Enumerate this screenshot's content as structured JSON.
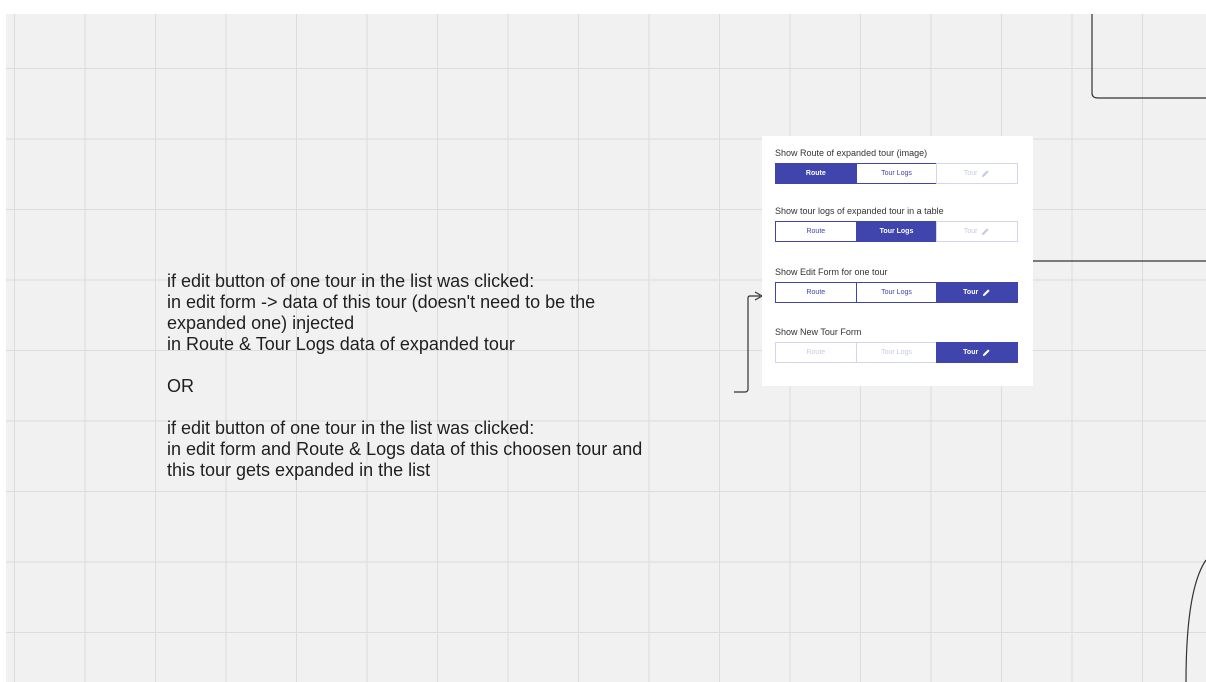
{
  "note": {
    "lines": [
      "if edit button of one tour in the list was clicked:",
      "in edit form -> data of this tour (doesn't need to be the",
      "expanded one) injected",
      "in Route & Tour Logs data of expanded tour",
      "",
      "OR",
      "",
      "if edit button of one tour in the list was clicked:",
      "in edit form and Route & Logs data of this choosen tour and",
      "this tour gets expanded in the list"
    ]
  },
  "panel": {
    "groups": [
      {
        "label": "Show Route of expanded tour (image)",
        "buttons": [
          {
            "label": "Route",
            "state": "active"
          },
          {
            "label": "Tour Logs",
            "state": "normal"
          },
          {
            "label": "Tour",
            "state": "disabled",
            "icon": "pencil-icon"
          }
        ]
      },
      {
        "label": "Show tour logs of expanded tour in a table",
        "buttons": [
          {
            "label": "Route",
            "state": "normal"
          },
          {
            "label": "Tour Logs",
            "state": "active"
          },
          {
            "label": "Tour",
            "state": "disabled",
            "icon": "pencil-icon"
          }
        ]
      },
      {
        "label": "Show Edit Form for one tour",
        "buttons": [
          {
            "label": "Route",
            "state": "normal"
          },
          {
            "label": "Tour Logs",
            "state": "normal"
          },
          {
            "label": "Tour",
            "state": "active",
            "icon": "pencil-icon"
          }
        ]
      },
      {
        "label": "Show New Tour Form",
        "buttons": [
          {
            "label": "Route",
            "state": "disabled"
          },
          {
            "label": "Tour Logs",
            "state": "disabled"
          },
          {
            "label": "Tour",
            "state": "active",
            "icon": "pencil-icon"
          }
        ]
      }
    ]
  },
  "colors": {
    "accent": "#3f45ad",
    "canvas": "#f1f1f1",
    "grid": "#dcdcdc",
    "connector": "#333333"
  }
}
